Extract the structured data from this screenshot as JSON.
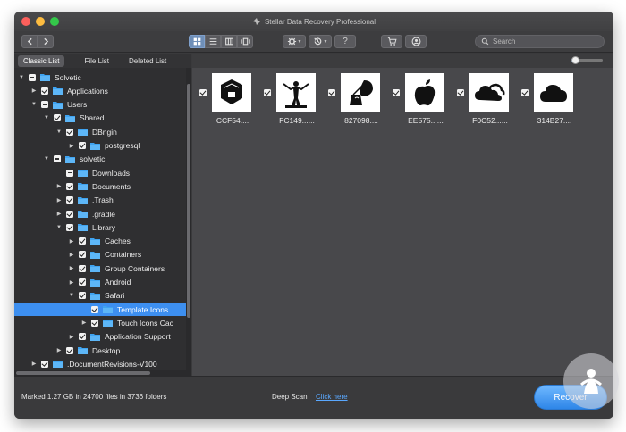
{
  "window": {
    "title": "Stellar Data Recovery Professional"
  },
  "toolbar": {
    "search_placeholder": "Search",
    "help_label": "?"
  },
  "tabs": [
    {
      "label": "Classic List",
      "active": true
    },
    {
      "label": "File List",
      "active": false
    },
    {
      "label": "Deleted List",
      "active": false
    }
  ],
  "tree": [
    {
      "label": "Solvetic",
      "level": 0,
      "expanded": true,
      "state": "partial",
      "selected": false
    },
    {
      "label": "Applications",
      "level": 1,
      "expanded": false,
      "state": "checked",
      "selected": false
    },
    {
      "label": "Users",
      "level": 1,
      "expanded": true,
      "state": "partial",
      "selected": false
    },
    {
      "label": "Shared",
      "level": 2,
      "expanded": true,
      "state": "checked",
      "selected": false
    },
    {
      "label": "DBngin",
      "level": 3,
      "expanded": true,
      "state": "checked",
      "selected": false
    },
    {
      "label": "postgresql",
      "level": 4,
      "expanded": false,
      "state": "checked",
      "selected": false
    },
    {
      "label": "solvetic",
      "level": 2,
      "expanded": true,
      "state": "partial",
      "selected": false
    },
    {
      "label": "Downloads",
      "level": 3,
      "expanded": null,
      "state": "partial",
      "selected": false
    },
    {
      "label": "Documents",
      "level": 3,
      "expanded": false,
      "state": "checked",
      "selected": false
    },
    {
      "label": ".Trash",
      "level": 3,
      "expanded": false,
      "state": "checked",
      "selected": false
    },
    {
      "label": ".gradle",
      "level": 3,
      "expanded": false,
      "state": "checked",
      "selected": false
    },
    {
      "label": "Library",
      "level": 3,
      "expanded": true,
      "state": "checked",
      "selected": false
    },
    {
      "label": "Caches",
      "level": 4,
      "expanded": false,
      "state": "checked",
      "selected": false
    },
    {
      "label": "Containers",
      "level": 4,
      "expanded": false,
      "state": "checked",
      "selected": false
    },
    {
      "label": "Group Containers",
      "level": 4,
      "expanded": false,
      "state": "checked",
      "selected": false
    },
    {
      "label": "Android",
      "level": 4,
      "expanded": false,
      "state": "checked",
      "selected": false
    },
    {
      "label": "Safari",
      "level": 4,
      "expanded": true,
      "state": "checked",
      "selected": false
    },
    {
      "label": "Template Icons",
      "level": 5,
      "expanded": null,
      "state": "checked",
      "selected": true
    },
    {
      "label": "Touch Icons Cac",
      "level": 5,
      "expanded": false,
      "state": "checked",
      "selected": false
    },
    {
      "label": "Application Support",
      "level": 4,
      "expanded": false,
      "state": "checked",
      "selected": false
    },
    {
      "label": "Desktop",
      "level": 3,
      "expanded": false,
      "state": "checked",
      "selected": false
    },
    {
      "label": ".DocumentRevisions-V100",
      "level": 1,
      "expanded": false,
      "state": "checked",
      "selected": false
    }
  ],
  "files": [
    {
      "name": "CCF54....",
      "icon": "hexagon-box-icon"
    },
    {
      "name": "FC149......",
      "icon": "person-figure-icon"
    },
    {
      "name": "827098....",
      "icon": "leaf-bag-icon"
    },
    {
      "name": "EE575......",
      "icon": "apple-logo-icon"
    },
    {
      "name": "F0C52......",
      "icon": "double-cloud-icon"
    },
    {
      "name": "314B27....",
      "icon": "cloud-icon"
    }
  ],
  "zoom_slider": {
    "value": 0.15
  },
  "status": {
    "marked": "Marked 1.27 GB in 24700 files in 3736 folders",
    "deep_scan_label": "Deep Scan",
    "click_here": "Click here",
    "recover_label": "Recover"
  },
  "colors": {
    "accent": "#3d8ff0",
    "folder": "#3fa3f0",
    "link": "#5aa8ff"
  }
}
